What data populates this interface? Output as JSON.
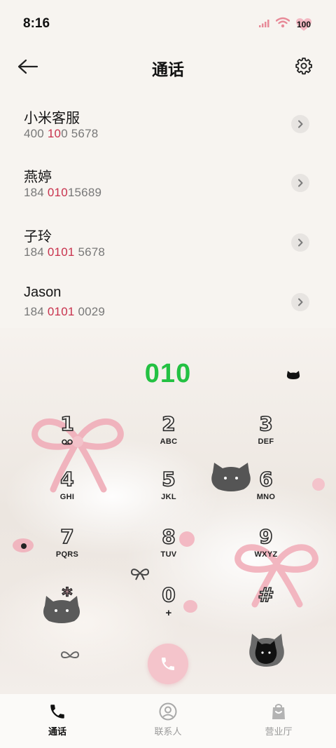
{
  "status_bar": {
    "time": "8:16",
    "battery": "100"
  },
  "header": {
    "title": "通话"
  },
  "contacts": [
    {
      "name": "小米客服",
      "number_parts": [
        "400 ",
        "10",
        "0 5678"
      ]
    },
    {
      "name": "燕婷",
      "number_parts": [
        "184 ",
        "010",
        "15689"
      ]
    },
    {
      "name": "子玲",
      "number_parts": [
        "184 ",
        "0101",
        " 5678"
      ]
    },
    {
      "name": "Jason",
      "number_parts": [
        "184 ",
        "0101",
        " 0029"
      ]
    }
  ],
  "dialer": {
    "number": "010",
    "keys": [
      {
        "digit": "1",
        "letters": ""
      },
      {
        "digit": "2",
        "letters": "ABC"
      },
      {
        "digit": "3",
        "letters": "DEF"
      },
      {
        "digit": "4",
        "letters": "GHI"
      },
      {
        "digit": "5",
        "letters": "JKL"
      },
      {
        "digit": "6",
        "letters": "MNO"
      },
      {
        "digit": "7",
        "letters": "PQRS"
      },
      {
        "digit": "8",
        "letters": "TUV"
      },
      {
        "digit": "9",
        "letters": "WXYZ"
      },
      {
        "digit": "*",
        "letters": ""
      },
      {
        "digit": "0",
        "letters": "+"
      },
      {
        "digit": "#",
        "letters": ""
      }
    ]
  },
  "bottom_nav": [
    {
      "label": "通话",
      "icon": "phone-icon",
      "active": true
    },
    {
      "label": "联系人",
      "icon": "contacts-icon",
      "active": false
    },
    {
      "label": "营业厅",
      "icon": "store-bag-icon",
      "active": false
    }
  ],
  "colors": {
    "accent_green": "#23c142",
    "highlight_red": "#c8324d",
    "call_button_pink": "#f4c4cb"
  }
}
